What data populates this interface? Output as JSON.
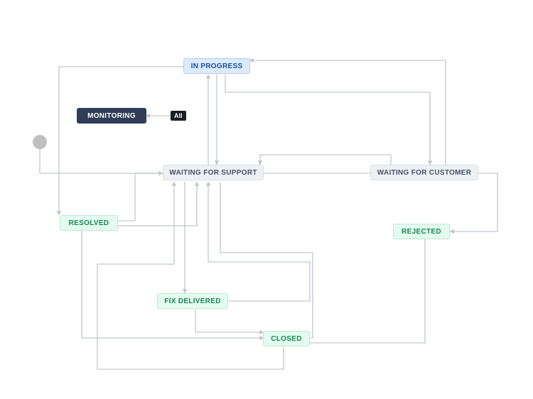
{
  "chart_data": {
    "type": "workflow",
    "title": "",
    "nodes": [
      {
        "id": "start",
        "label": "",
        "kind": "start"
      },
      {
        "id": "in-progress",
        "label": "IN PROGRESS",
        "kind": "blue"
      },
      {
        "id": "monitoring",
        "label": "MONITORING",
        "kind": "dark"
      },
      {
        "id": "waiting-for-support",
        "label": "WAITING FOR SUPPORT",
        "kind": "gray"
      },
      {
        "id": "waiting-for-customer",
        "label": "WAITING FOR CUSTOMER",
        "kind": "gray"
      },
      {
        "id": "resolved",
        "label": "RESOLVED",
        "kind": "green"
      },
      {
        "id": "rejected",
        "label": "REJECTED",
        "kind": "green"
      },
      {
        "id": "fix-delivered",
        "label": "FIX DELIVERED",
        "kind": "green"
      },
      {
        "id": "closed",
        "label": "CLOSED",
        "kind": "green"
      }
    ],
    "global_transition": {
      "label": "All",
      "target": "monitoring"
    },
    "edges": [
      {
        "from": "start",
        "to": "waiting-for-support"
      },
      {
        "from": "in-progress",
        "to": "waiting-for-support"
      },
      {
        "from": "in-progress",
        "to": "waiting-for-customer"
      },
      {
        "from": "in-progress",
        "to": "resolved"
      },
      {
        "from": "waiting-for-support",
        "to": "in-progress"
      },
      {
        "from": "waiting-for-support",
        "to": "waiting-for-customer"
      },
      {
        "from": "waiting-for-support",
        "to": "resolved"
      },
      {
        "from": "waiting-for-support",
        "to": "closed"
      },
      {
        "from": "waiting-for-support",
        "to": "fix-delivered"
      },
      {
        "from": "waiting-for-customer",
        "to": "in-progress"
      },
      {
        "from": "waiting-for-customer",
        "to": "waiting-for-support"
      },
      {
        "from": "waiting-for-customer",
        "to": "rejected"
      },
      {
        "from": "resolved",
        "to": "waiting-for-support"
      },
      {
        "from": "resolved",
        "to": "closed"
      },
      {
        "from": "fix-delivered",
        "to": "closed"
      },
      {
        "from": "fix-delivered",
        "to": "waiting-for-support"
      },
      {
        "from": "rejected",
        "to": "closed"
      },
      {
        "from": "closed",
        "to": "waiting-for-support"
      }
    ]
  },
  "nodes": {
    "in_progress": {
      "label": "IN PROGRESS"
    },
    "monitoring": {
      "label": "MONITORING"
    },
    "waiting_for_support": {
      "label": "WAITING FOR SUPPORT"
    },
    "waiting_for_customer": {
      "label": "WAITING FOR CUSTOMER"
    },
    "resolved": {
      "label": "RESOLVED"
    },
    "rejected": {
      "label": "REJECTED"
    },
    "fix_delivered": {
      "label": "FIX DELIVERED"
    },
    "closed": {
      "label": "CLOSED"
    }
  },
  "badges": {
    "all": "All"
  }
}
